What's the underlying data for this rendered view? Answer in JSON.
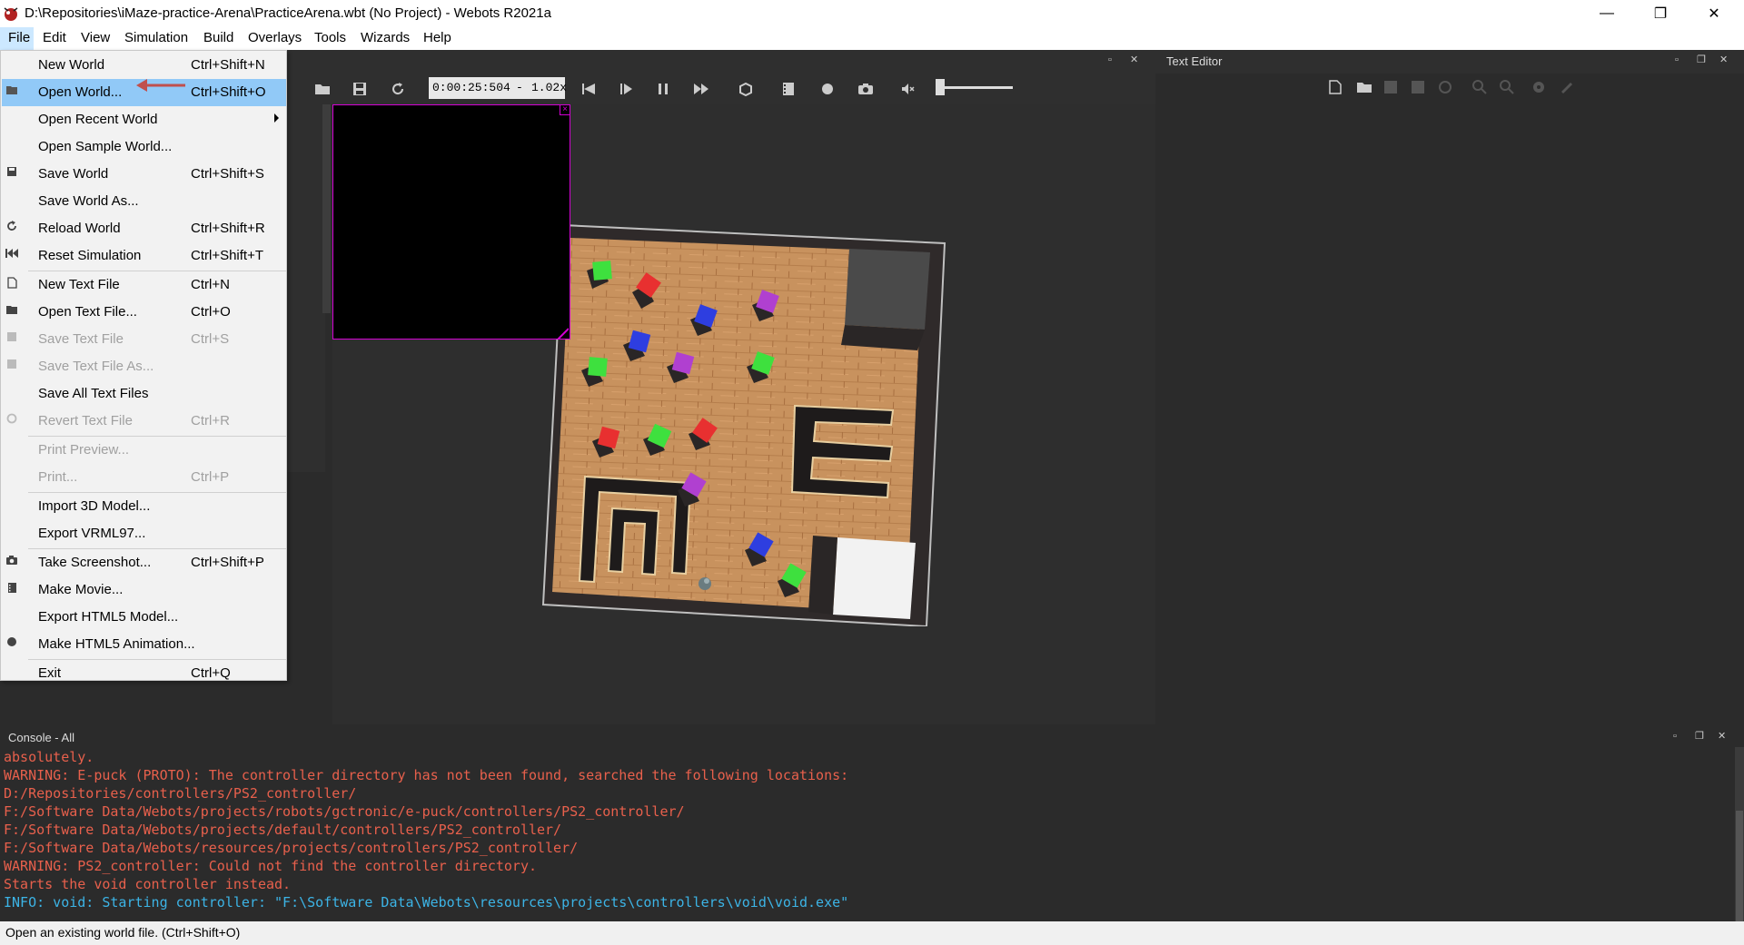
{
  "window": {
    "title": "D:\\Repositories\\iMaze-practice-Arena\\PracticeArena.wbt (No Project) - Webots R2021a",
    "minimize": "—",
    "restore": "❐",
    "close": "✕"
  },
  "menubar": {
    "items": [
      "File",
      "Edit",
      "View",
      "Simulation",
      "Build",
      "Overlays",
      "Tools",
      "Wizards",
      "Help"
    ]
  },
  "file_menu": {
    "items": [
      {
        "label": "New World",
        "shortcut": "Ctrl+Shift+N",
        "icon": "none",
        "enabled": true
      },
      {
        "label": "Open World...",
        "shortcut": "Ctrl+Shift+O",
        "icon": "folder-icon",
        "enabled": true,
        "highlighted": true
      },
      {
        "label": "Open Recent World",
        "shortcut": "",
        "icon": "none",
        "enabled": true,
        "submenu": true
      },
      {
        "label": "Open Sample World...",
        "shortcut": "",
        "icon": "none",
        "enabled": true
      },
      {
        "label": "Save World",
        "shortcut": "Ctrl+Shift+S",
        "icon": "save-icon",
        "enabled": true
      },
      {
        "label": "Save World As...",
        "shortcut": "",
        "icon": "none",
        "enabled": true
      },
      {
        "label": "Reload World",
        "shortcut": "Ctrl+Shift+R",
        "icon": "reload-icon",
        "enabled": true
      },
      {
        "label": "Reset Simulation",
        "shortcut": "Ctrl+Shift+T",
        "icon": "reset-icon",
        "enabled": true
      },
      {
        "label": "New Text File",
        "shortcut": "Ctrl+N",
        "icon": "new-file-icon",
        "enabled": true
      },
      {
        "label": "Open Text File...",
        "shortcut": "Ctrl+O",
        "icon": "folder-icon",
        "enabled": true
      },
      {
        "label": "Save Text File",
        "shortcut": "Ctrl+S",
        "icon": "save-icon",
        "enabled": false
      },
      {
        "label": "Save Text File As...",
        "shortcut": "",
        "icon": "save-as-icon",
        "enabled": false
      },
      {
        "label": "Save All Text Files",
        "shortcut": "",
        "icon": "none",
        "enabled": true
      },
      {
        "label": "Revert Text File",
        "shortcut": "Ctrl+R",
        "icon": "revert-icon",
        "enabled": false
      },
      {
        "label": "Print Preview...",
        "shortcut": "",
        "icon": "none",
        "enabled": false
      },
      {
        "label": "Print...",
        "shortcut": "Ctrl+P",
        "icon": "none",
        "enabled": false
      },
      {
        "label": "Import 3D Model...",
        "shortcut": "",
        "icon": "none",
        "enabled": true
      },
      {
        "label": "Export VRML97...",
        "shortcut": "",
        "icon": "none",
        "enabled": true
      },
      {
        "label": "Take Screenshot...",
        "shortcut": "Ctrl+Shift+P",
        "icon": "camera-icon",
        "enabled": true
      },
      {
        "label": "Make Movie...",
        "shortcut": "",
        "icon": "movie-icon",
        "enabled": true
      },
      {
        "label": "Export HTML5 Model...",
        "shortcut": "",
        "icon": "none",
        "enabled": true
      },
      {
        "label": "Make HTML5 Animation...",
        "shortcut": "",
        "icon": "record-icon",
        "enabled": true
      },
      {
        "label": "Exit",
        "shortcut": "Ctrl+Q",
        "icon": "none",
        "enabled": true
      }
    ]
  },
  "toolbar": {
    "time": "0:00:25:504",
    "speed_dash": "-",
    "speed": "1.02x"
  },
  "editor": {
    "title": "Text Editor"
  },
  "console": {
    "title": "Console - All",
    "lines": [
      {
        "text": "absolutely.",
        "color": "#e8604c"
      },
      {
        "text": "WARNING: E-puck (PROTO): The controller directory has not been found, searched the following locations:",
        "color": "#e8604c"
      },
      {
        "text": "D:/Repositories/controllers/PS2_controller/",
        "color": "#e8604c"
      },
      {
        "text": "F:/Software Data/Webots/projects/robots/gctronic/e-puck/controllers/PS2_controller/",
        "color": "#e8604c"
      },
      {
        "text": "F:/Software Data/Webots/projects/default/controllers/PS2_controller/",
        "color": "#e8604c"
      },
      {
        "text": "F:/Software Data/Webots/resources/projects/controllers/PS2_controller/",
        "color": "#e8604c"
      },
      {
        "text": "WARNING: PS2_controller: Could not find the controller directory.",
        "color": "#e8604c"
      },
      {
        "text": "Starts the void controller instead.",
        "color": "#e8604c"
      },
      {
        "text": "INFO: void: Starting controller: \"F:\\Software Data\\Webots\\resources\\projects\\controllers\\void\\void.exe\"",
        "color": "#3cb4e6"
      }
    ]
  },
  "statusbar": {
    "text": "Open an existing world file. (Ctrl+Shift+O)"
  },
  "colors": {
    "menu_highlight": "#91c9f7",
    "overlay_border": "#d400d4",
    "console_warning": "#e8604c",
    "console_info": "#3cb4e6",
    "floor": "#c8925e"
  }
}
